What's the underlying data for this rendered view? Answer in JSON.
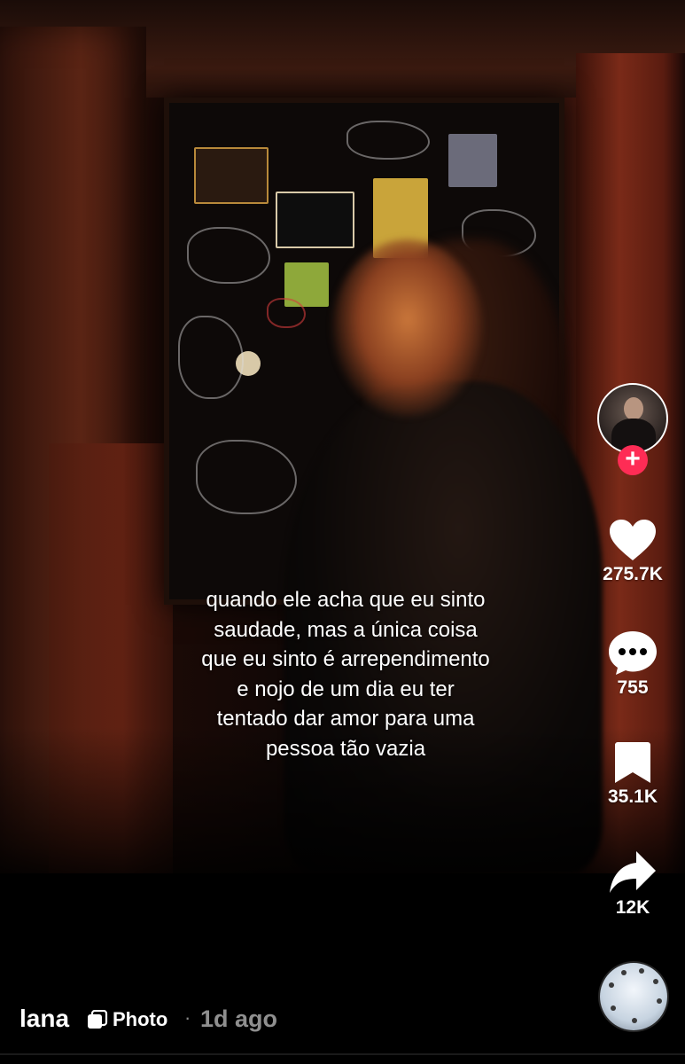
{
  "post": {
    "caption": "quando ele acha que eu sinto\nsaudade, mas a única coisa\nque eu sinto é arrependimento\ne nojo de um dia eu ter\ntentado dar amor para uma\npessoa tão vazia",
    "username": "lana",
    "type_label": "Photo",
    "separator": "·",
    "time_ago": "1d ago"
  },
  "actions": {
    "likes": "275.7K",
    "comments": "755",
    "saves": "35.1K",
    "shares": "12K"
  },
  "follow_symbol": "+",
  "icons": {
    "like": "heart-icon",
    "comment": "comment-bubble-icon",
    "save": "bookmark-icon",
    "share": "share-arrow-icon",
    "photo": "photo-carousel-icon"
  },
  "colors": {
    "follow_accent": "#fe2c55",
    "text": "#ffffff",
    "muted_text": "#8f8f8f"
  }
}
